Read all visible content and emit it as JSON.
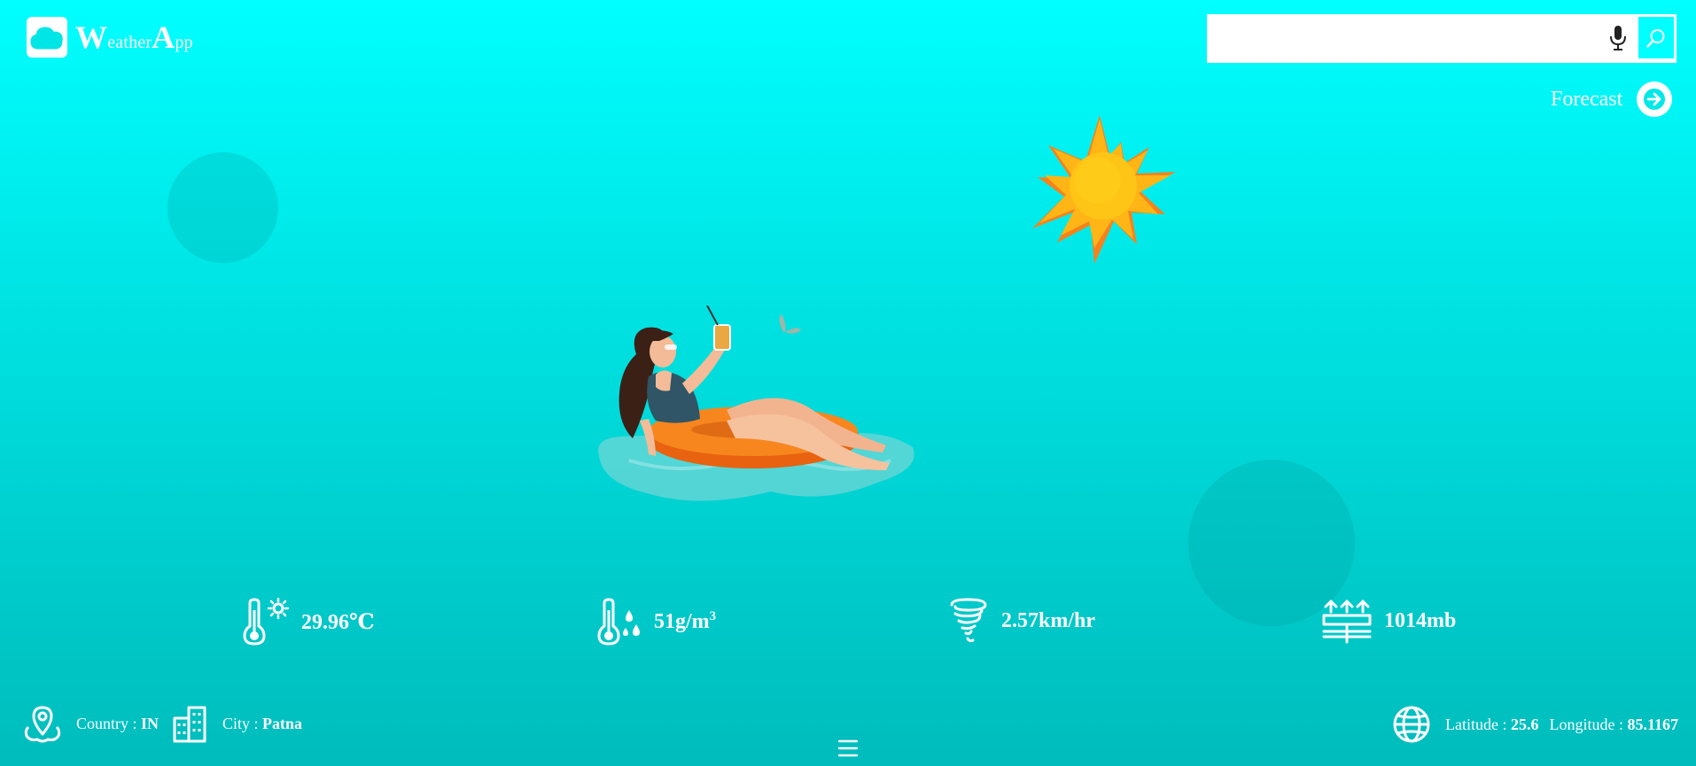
{
  "app": {
    "logo_W": "W",
    "logo_eather": "eather",
    "logo_A": "A",
    "logo_pp": "pp"
  },
  "search": {
    "value": "",
    "placeholder": ""
  },
  "forecast": {
    "label": "Forecast"
  },
  "metrics": {
    "temperature": "29.96℃",
    "humidity_value": "51g/m",
    "humidity_exp": "3",
    "wind": "2.57km/hr",
    "pressure": "1014mb"
  },
  "location": {
    "country_label": "Country : ",
    "country": "IN",
    "city_label": "City : ",
    "city": "Patna",
    "latitude_label": "Latitude : ",
    "latitude": "25.6",
    "longitude_label": "Longitude : ",
    "longitude": "85.1167"
  },
  "menu": {
    "glyph": "☰"
  },
  "colors": {
    "background_top": "#00ffff",
    "background_bottom": "#00bcbc",
    "sun_yellow": "#ffc21a",
    "sun_orange": "#f7821b",
    "float_ring": "#f7861e"
  },
  "icons": {
    "logo": "cloud-icon",
    "microphone": "microphone-icon",
    "search": "search-icon",
    "forecast": "arrow-right-icon",
    "temperature": "thermometer-sun-icon",
    "humidity": "thermometer-drops-icon",
    "wind": "tornado-icon",
    "pressure": "pressure-icon",
    "country": "map-pin-icon",
    "city": "buildings-icon",
    "coordinates": "globe-icon"
  }
}
